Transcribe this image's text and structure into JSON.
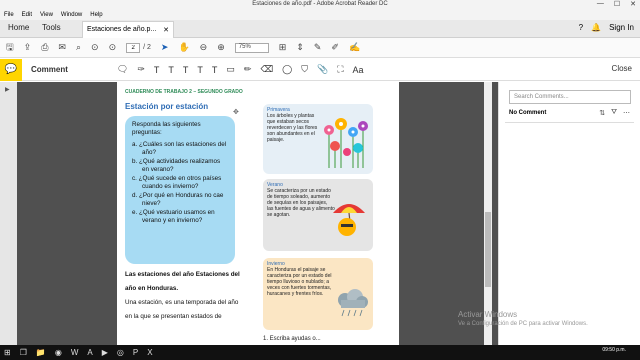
{
  "window": {
    "title": "Estaciones de año.pdf - Adobe Acrobat Reader DC",
    "controls": [
      "—",
      "☐",
      "✕"
    ]
  },
  "menu": [
    "File",
    "Edit",
    "View",
    "Window",
    "Help"
  ],
  "tabs": {
    "home": "Home",
    "tools": "Tools",
    "document": "Estaciones de año.p...",
    "signin": "Sign In"
  },
  "toolbar": {
    "page_current": "2",
    "page_total": "/ 2",
    "zoom": "75%"
  },
  "comment": {
    "label": "Comment",
    "close": "Close"
  },
  "sidepanel": {
    "search_placeholder": "Search Comments...",
    "no_comment": "No Comment"
  },
  "page": {
    "header": "CUADERNO DE TRABAJO 2 – SEGUNDO GRADO",
    "heading": "Estación por estación",
    "intro": "Responda las siguientes preguntas:",
    "questions": [
      "a. ¿Cuáles son las estaciones del año?",
      "b. ¿Qué actividades realizamos en verano?",
      "c. ¿Qué sucede en otros países cuando es invierno?",
      "d. ¿Por qué en Honduras no cae nieve?",
      "e. ¿Qué vestuario usamos en verano y en invierno?"
    ],
    "body_bold": "Las estaciones del año Estaciones del año en Honduras.",
    "body_text": "Una estación, es una temporada del año en la que se presentan estados de",
    "spring": {
      "title": "Primavera",
      "text": "Los árboles y plantas que estaban secos reverdecen y las flores son abundantes en el paisaje."
    },
    "summer": {
      "title": "Verano",
      "text": "Se caracteriza por un estado de tiempo soleado, aumento de sequías en los paisajes, las fuentes de agua y alimento se agotan."
    },
    "winter": {
      "title": "Invierno",
      "text": "En Honduras el paisaje se caracteriza por un estado del tiempo lluvioso o nublado; a veces con fuertes tormentas, huracanes y frentes fríos."
    },
    "escribe": "1. Escriba ayudas o..."
  },
  "watermark": {
    "line1": "Activar Windows",
    "line2": "Ve a Configuración de PC para activar Windows."
  },
  "taskbar": {
    "time": "09:50 p.m."
  }
}
